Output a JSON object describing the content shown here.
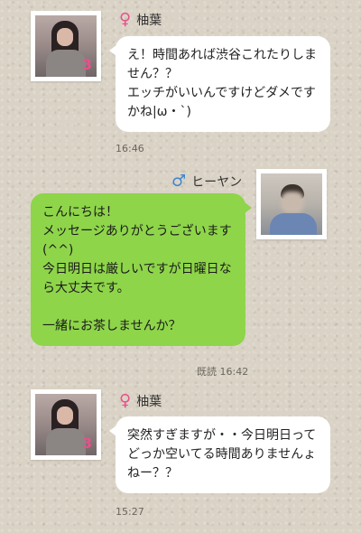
{
  "messages": [
    {
      "sender": "柚葉",
      "gender": "female-icon",
      "lines": [
        "え！時間あれば渋谷これたりしま",
        "せん？？",
        "エッチがいいんですけどダメです",
        "かね|ω・`)"
      ],
      "time": "16:46"
    },
    {
      "sender": "ヒーヤン",
      "gender": "male-icon",
      "lines": [
        "こんにちは！",
        "メッセージありがとうございます",
        "(^^)",
        "今日明日は厳しいですが日曜日な",
        "ら大丈夫です。",
        "",
        "一緒にお茶しませんか？"
      ],
      "read_label": "既読",
      "time": "16:42"
    },
    {
      "sender": "柚葉",
      "gender": "female-icon",
      "lines": [
        "突然すぎますが・・今日明日って",
        "どっか空いてる時間ありませんょ",
        "ねー？？"
      ],
      "time": "15:27"
    }
  ],
  "avatar_badge": "3",
  "colors": {
    "background": "#d9d2c5",
    "bubble_incoming": "#ffffff",
    "bubble_outgoing": "#8ed54a",
    "female_icon": "#e8508a",
    "male_icon": "#3f86cc"
  }
}
